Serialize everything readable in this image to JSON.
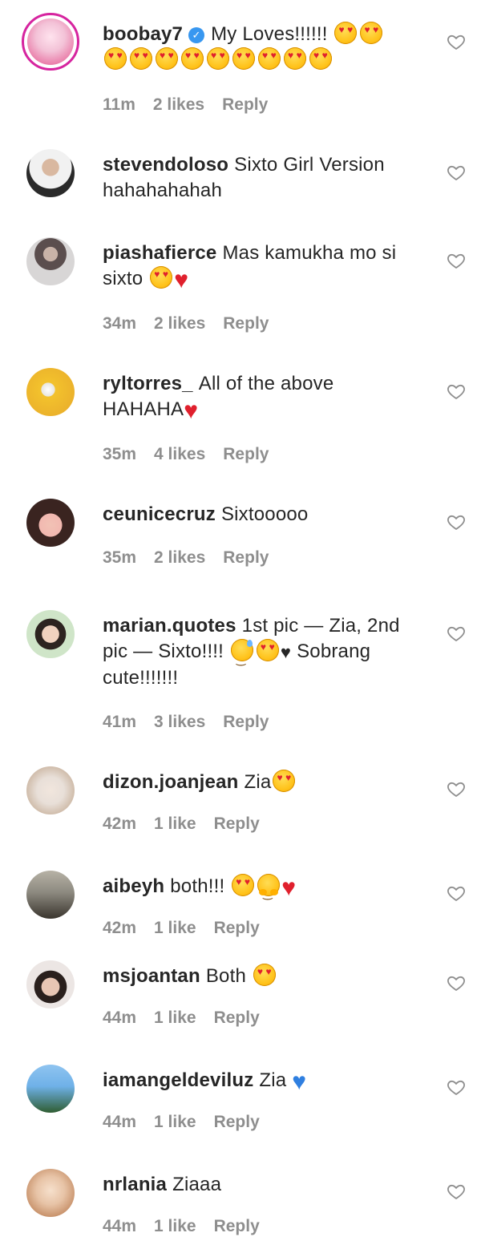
{
  "comments": [
    {
      "username": "boobay7",
      "verified": true,
      "lines": [
        "My Loves!!!!!!",
        ""
      ],
      "time": "11m",
      "likes": "2 likes",
      "reply": "Reply",
      "avatar_colors": [
        "#f3c2d7",
        "#e34f8a"
      ]
    },
    {
      "username": "stevendoloso",
      "text": "Sixto Girl Version hahahahahah",
      "avatar_colors": [
        "#f1f1f1",
        "#2a2a2a"
      ]
    },
    {
      "username": "piashafierce",
      "text": "Mas kamukha mo si sixto",
      "time": "34m",
      "likes": "2 likes",
      "reply": "Reply",
      "avatar_colors": [
        "#d8d6d6",
        "#5b4e4e"
      ]
    },
    {
      "username": "ryltorres_",
      "text": "All of the above HAHAHA",
      "time": "35m",
      "likes": "4 likes",
      "reply": "Reply",
      "avatar_colors": [
        "#f3c22d",
        "#e7a92a"
      ]
    },
    {
      "username": "ceunicecruz",
      "text": "Sixtooooo",
      "time": "35m",
      "likes": "2 likes",
      "reply": "Reply",
      "avatar_colors": [
        "#f2b8b0",
        "#3a2420"
      ]
    },
    {
      "username": "marian.quotes",
      "text_a": "1st pic — Zia, 2nd pic — Sixto!!!!",
      "text_b": "Sobrang cute!!!!!!!",
      "time": "41m",
      "likes": "3 likes",
      "reply": "Reply",
      "avatar_colors": [
        "#cfe5c8",
        "#2d2420"
      ]
    },
    {
      "username": "dizon.joanjean",
      "text": "Zia",
      "time": "42m",
      "likes": "1 like",
      "reply": "Reply",
      "avatar_colors": [
        "#e8dfd8",
        "#b99c80"
      ]
    },
    {
      "username": "aibeyh",
      "text": "both!!!",
      "time": "42m",
      "likes": "1 like",
      "reply": "Reply",
      "avatar_colors": [
        "#8d8a80",
        "#3a352e"
      ]
    },
    {
      "username": "msjoantan",
      "text": "Both",
      "time": "44m",
      "likes": "1 like",
      "reply": "Reply",
      "avatar_colors": [
        "#ece6e4",
        "#2a201d"
      ]
    },
    {
      "username": "iamangeldeviluz",
      "text": "Zia",
      "time": "44m",
      "likes": "1 like",
      "reply": "Reply",
      "avatar_colors": [
        "#6fb1e8",
        "#2f5d32"
      ]
    },
    {
      "username": "nrlania",
      "text": "Ziaaa",
      "time": "44m",
      "likes": "1 like",
      "reply": "Reply",
      "avatar_colors": [
        "#e7c3a6",
        "#b06c3d"
      ]
    }
  ]
}
